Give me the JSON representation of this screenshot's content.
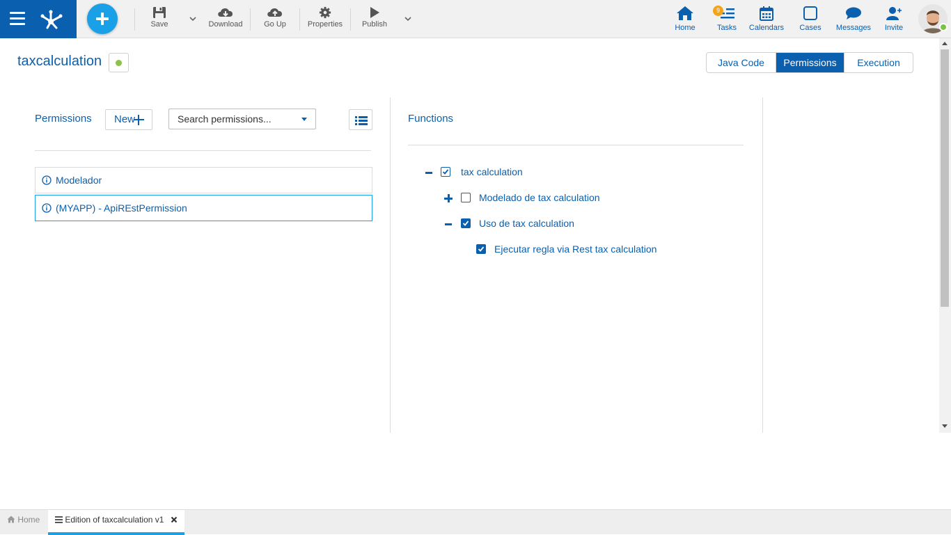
{
  "toolbar": {
    "save": "Save",
    "download": "Download",
    "go_up": "Go Up",
    "properties": "Properties",
    "publish": "Publish"
  },
  "nav": {
    "home": "Home",
    "tasks": "Tasks",
    "tasks_badge": "9",
    "calendars": "Calendars",
    "cases": "Cases",
    "messages": "Messages",
    "invite": "Invite"
  },
  "header": {
    "title": "taxcalculation",
    "status_color": "#8bc34a",
    "tabs": [
      "Java Code",
      "Permissions",
      "Execution"
    ],
    "active_tab": "Permissions"
  },
  "permissions": {
    "label": "Permissions",
    "new_label": "New",
    "search_placeholder": "Search permissions...",
    "items": [
      {
        "label": "Modelador",
        "selected": false
      },
      {
        "label": "(MYAPP) - ApiREstPermission",
        "selected": true
      }
    ]
  },
  "functions": {
    "label": "Functions",
    "tree": [
      {
        "label": "tax calculation",
        "toggle": "minus",
        "checked": true
      },
      {
        "label": "Modelado de tax calculation",
        "toggle": "plus",
        "checked": false
      },
      {
        "label": "Uso de tax calculation",
        "toggle": "minus",
        "checked": true
      },
      {
        "label": "Ejecutar regla via Rest tax calculation",
        "toggle": "none",
        "checked": true
      }
    ]
  },
  "bottom_tabs": {
    "home": "Home",
    "edition": "Edition of taxcalculation v1"
  },
  "colors": {
    "brand": "#0a5fae",
    "accent": "#1aa0e6",
    "badge": "#f2a31b"
  }
}
